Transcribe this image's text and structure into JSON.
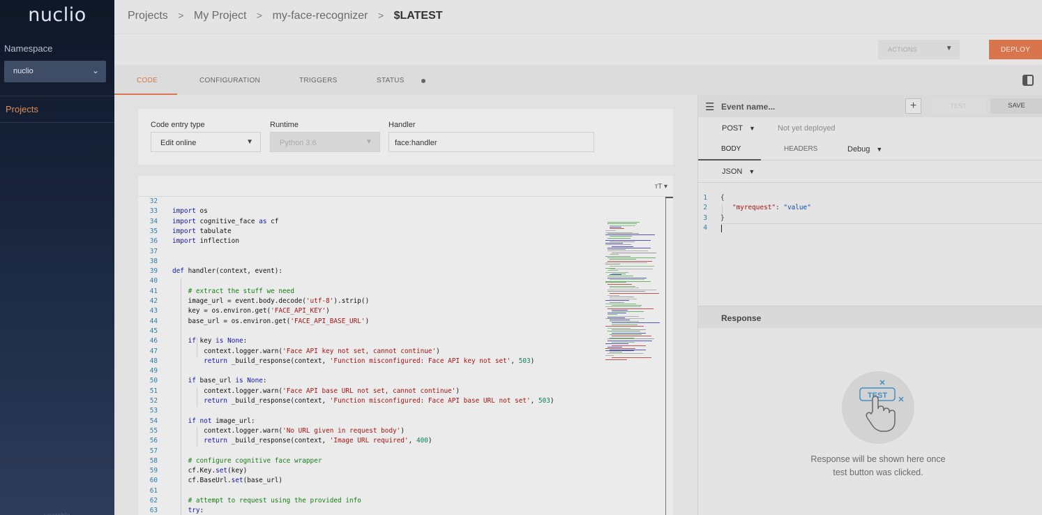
{
  "sidebar": {
    "logo": "nuclio",
    "namespace_label": "Namespace",
    "namespace_value": "nuclio",
    "nav_projects": "Projects",
    "version": "unstable"
  },
  "breadcrumb": {
    "items": [
      "Projects",
      "My Project",
      "my-face-recognizer"
    ],
    "current": "$LATEST",
    "separator": ">"
  },
  "toolbar": {
    "actions_label": "ACTIONS",
    "deploy_label": "DEPLOY"
  },
  "tabs": {
    "code": "CODE",
    "configuration": "CONFIGURATION",
    "triggers": "TRIGGERS",
    "status": "STATUS"
  },
  "code_config": {
    "entry_type_label": "Code entry type",
    "entry_type_value": "Edit online",
    "runtime_label": "Runtime",
    "runtime_value": "Python 3.6",
    "handler_label": "Handler",
    "handler_value": "face:handler"
  },
  "editor": {
    "font_tool": "ᴛT ▾"
  },
  "test_pane": {
    "event_placeholder": "Event name...",
    "plus_label": "+",
    "test_label": "TEST",
    "save_label": "SAVE",
    "method": "POST",
    "deploy_status": "Not yet deployed",
    "tab_body": "BODY",
    "tab_headers": "HEADERS",
    "log_level": "Debug",
    "body_format": "JSON",
    "response_title": "Response",
    "illustration_text": "TEST",
    "response_message_1": "Response will be shown here once",
    "response_message_2": "test button was clicked."
  },
  "colors": {
    "accent": "#d9754d",
    "sidebar_bg": "#1d2a44",
    "line_number": "#2e7da8"
  }
}
